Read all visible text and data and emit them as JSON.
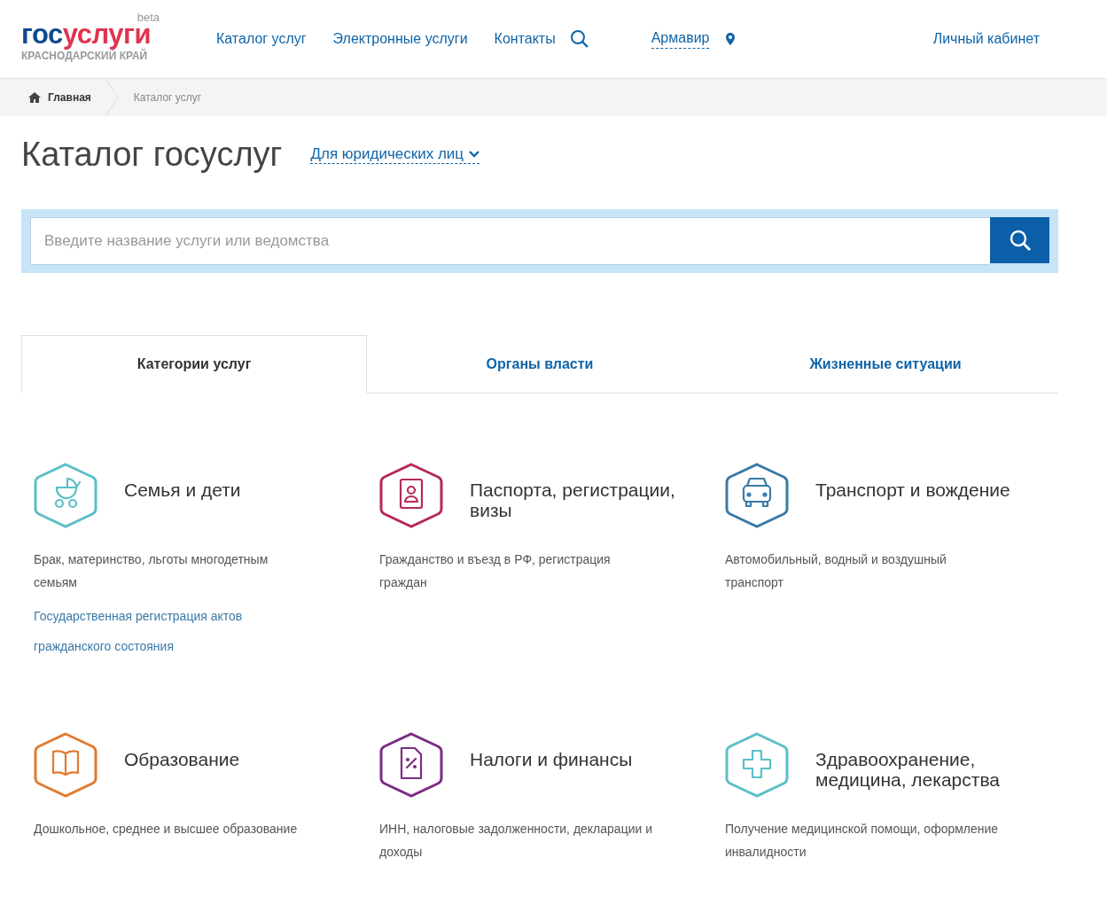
{
  "logo": {
    "main_a": "гос",
    "main_b": "услуги",
    "badge": "beta",
    "region": "КРАСНОДАРСКИЙ КРАЙ"
  },
  "nav": [
    "Каталог услуг",
    "Электронные услуги",
    "Контакты"
  ],
  "city": "Армавир",
  "account": "Личный кабинет",
  "breadcrumbs": [
    "Главная",
    "Каталог услуг"
  ],
  "page_title": "Каталог госуслуг",
  "audience": "Для юридических лиц",
  "search": {
    "placeholder": "Введите название услуги или ведомства"
  },
  "tabs": [
    {
      "label": "Категории услуг",
      "selected": true
    },
    {
      "label": "Органы власти",
      "selected": false
    },
    {
      "label": "Жизненные ситуации",
      "selected": false
    }
  ],
  "categories": [
    {
      "kind": "stroller",
      "color": "#5bbfc6",
      "title": "Семья и дети",
      "description": "Брак, материнство, льготы многодетным семьям",
      "links": [
        "Государственная регистрация актов гражданского состояния"
      ]
    },
    {
      "kind": "passport",
      "color": "#b5295a",
      "title": "Паспорта, регистрации, визы",
      "description": "Гражданство и въезд в РФ, регистрация граждан"
    },
    {
      "kind": "car",
      "color": "#3a7aa8",
      "title": "Транспорт и вождение",
      "description": "Автомобильный, водный и воздушный транспорт"
    },
    {
      "kind": "book",
      "color": "#e07b30",
      "title": "Образование",
      "description": "Дошкольное, среднее и высшее образование"
    },
    {
      "kind": "document",
      "color": "#7b2d83",
      "title": "Налоги и финансы",
      "description": "ИНН, налоговые задолженности, декларации и доходы"
    },
    {
      "kind": "cross",
      "color": "#5bbfc6",
      "title": "Здравоохранение, медицина, лекарства",
      "description": "Получение медицинской помощи, оформление инвалидности"
    }
  ]
}
